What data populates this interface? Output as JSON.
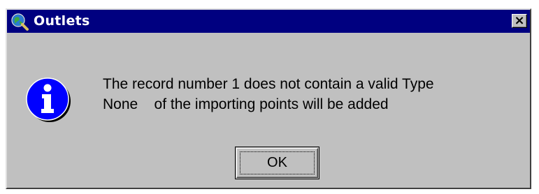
{
  "window": {
    "title": "Outlets",
    "title_icon": "globe-magnifier-icon",
    "close_label": "×"
  },
  "dialog": {
    "icon": "info-icon",
    "message_line1": "The record number 1 does not contain a valid Type",
    "message_line2": "None    of the importing points will be added"
  },
  "buttons": {
    "ok_label": "OK"
  },
  "colors": {
    "titlebar": "#000080",
    "face": "#c0c0c0",
    "info_blue": "#0000ff"
  }
}
